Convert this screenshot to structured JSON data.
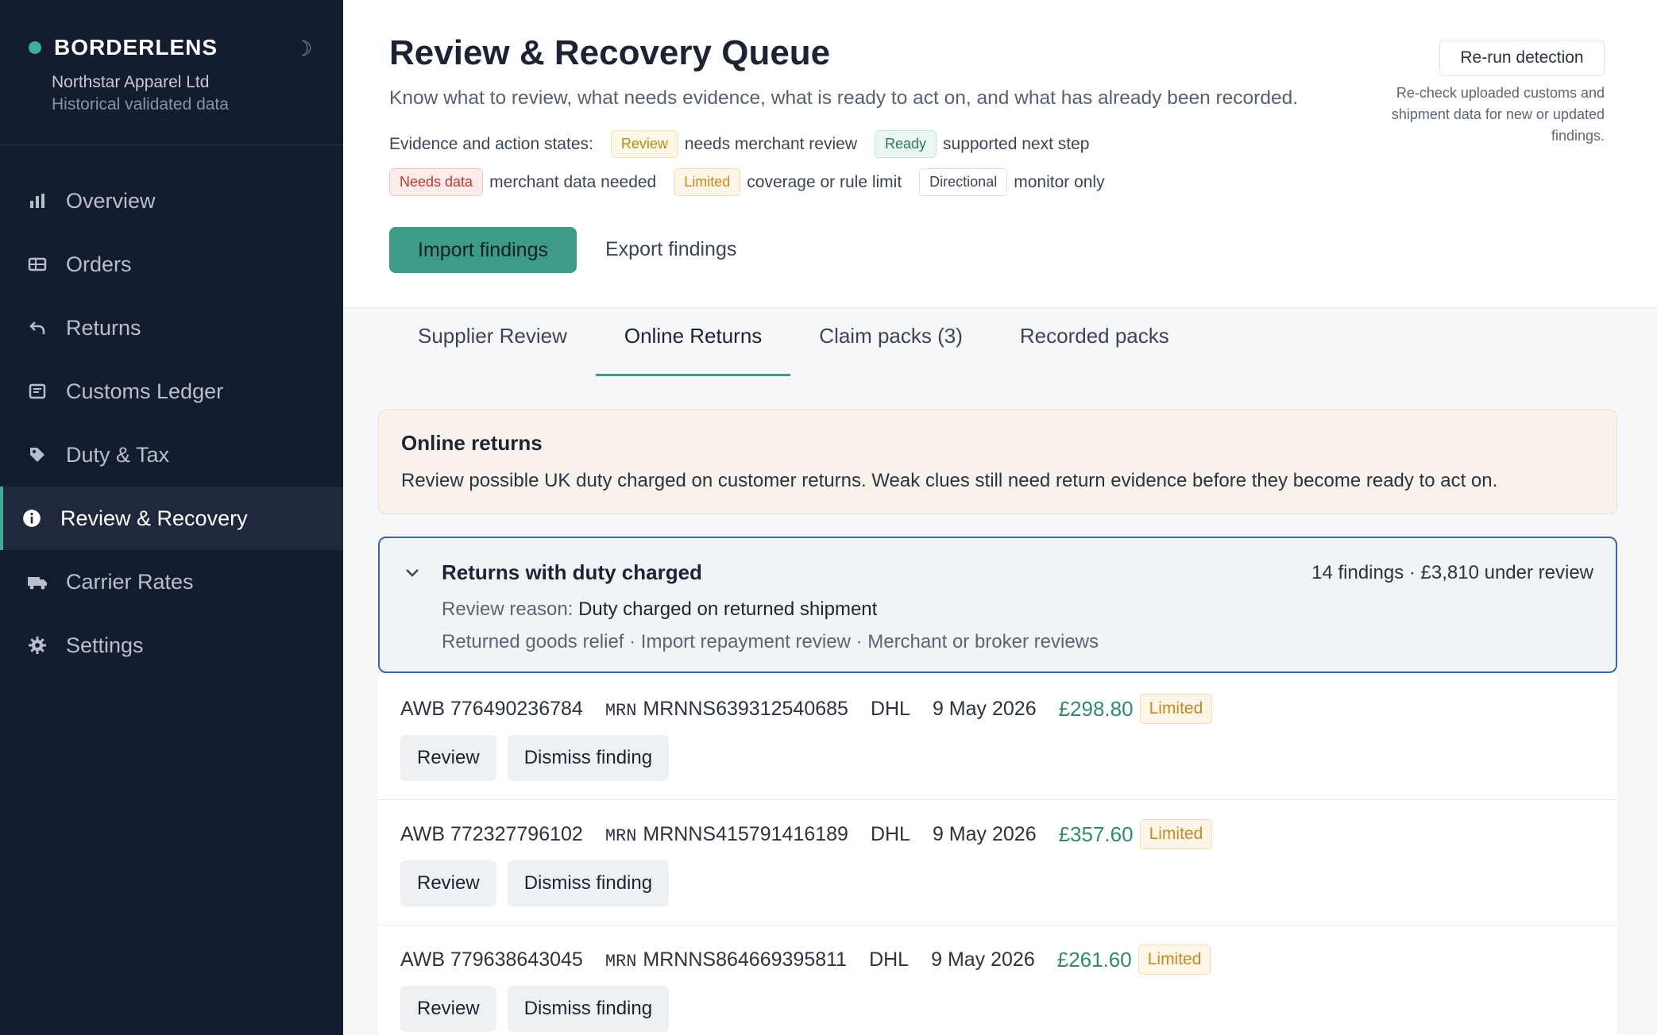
{
  "sidebar": {
    "brand": "BORDERLENS",
    "org_name": "Northstar Apparel Ltd",
    "org_sub": "Historical validated data",
    "theme_icon": "moon-icon",
    "items": [
      {
        "label": "Overview",
        "icon": "bar-chart-icon"
      },
      {
        "label": "Orders",
        "icon": "table-icon"
      },
      {
        "label": "Returns",
        "icon": "return-arrow-icon"
      },
      {
        "label": "Customs Ledger",
        "icon": "ledger-icon"
      },
      {
        "label": "Duty & Tax",
        "icon": "tag-icon"
      },
      {
        "label": "Review & Recovery",
        "icon": "info-icon",
        "active": true
      },
      {
        "label": "Carrier Rates",
        "icon": "truck-icon"
      },
      {
        "label": "Settings",
        "icon": "gear-icon"
      }
    ]
  },
  "header": {
    "title": "Review & Recovery Queue",
    "subtitle": "Know what to review, what needs evidence, what is ready to act on, and what has already been recorded.",
    "legend_label": "Evidence and action states:",
    "legend": [
      {
        "badge": "Review",
        "text": "needs merchant review"
      },
      {
        "badge": "Ready",
        "text": "supported next step"
      },
      {
        "badge": "Needs data",
        "text": "merchant data needed"
      },
      {
        "badge": "Limited",
        "text": "coverage or rule limit"
      },
      {
        "badge": "Directional",
        "text": "monitor only"
      }
    ],
    "import_label": "Import findings",
    "export_label": "Export findings",
    "rerun_label": "Re-run detection",
    "rerun_note": "Re-check uploaded customs and shipment data for new or updated findings."
  },
  "tabs": [
    {
      "label": "Supplier Review"
    },
    {
      "label": "Online Returns",
      "active": true
    },
    {
      "label": "Claim packs (3)"
    },
    {
      "label": "Recorded packs"
    }
  ],
  "notice": {
    "title": "Online returns",
    "text": "Review possible UK duty charged on customer returns. Weak clues still need return evidence before they become ready to act on."
  },
  "group": {
    "title": "Returns with duty charged",
    "summary": "14 findings · £3,810 under review",
    "reason_label": "Review reason:",
    "reason_value": "Duty charged on returned shipment",
    "tags": "Returned goods relief · Import repayment review · Merchant or broker reviews"
  },
  "rows": [
    {
      "awb": "AWB 776490236784",
      "mrn_label": "MRN",
      "mrn": "MRNNS639312540685",
      "carrier": "DHL",
      "date": "9 May 2026",
      "amount": "£298.80",
      "badge": "Limited",
      "review_label": "Review",
      "dismiss_label": "Dismiss finding"
    },
    {
      "awb": "AWB 772327796102",
      "mrn_label": "MRN",
      "mrn": "MRNNS415791416189",
      "carrier": "DHL",
      "date": "9 May 2026",
      "amount": "£357.60",
      "badge": "Limited",
      "review_label": "Review",
      "dismiss_label": "Dismiss finding"
    },
    {
      "awb": "AWB 779638643045",
      "mrn_label": "MRN",
      "mrn": "MRNNS864669395811",
      "carrier": "DHL",
      "date": "9 May 2026",
      "amount": "£261.60",
      "badge": "Limited",
      "review_label": "Review",
      "dismiss_label": "Dismiss finding"
    }
  ]
}
